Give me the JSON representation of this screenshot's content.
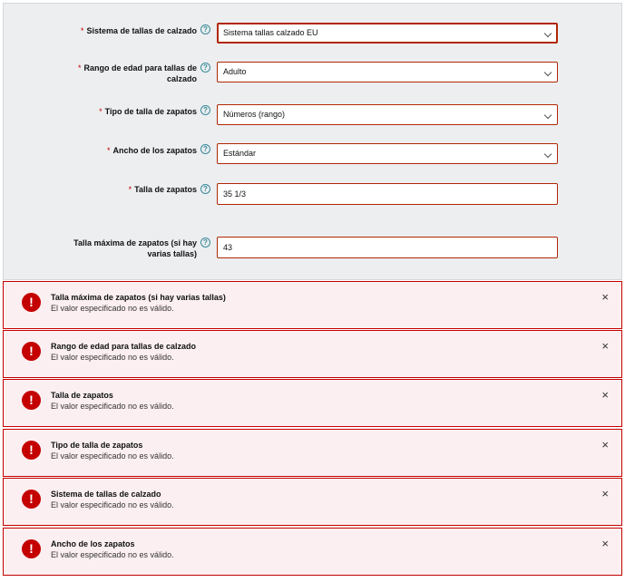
{
  "form": {
    "fields": [
      {
        "label": "Sistema de tallas de calzado",
        "required": "*",
        "help_icon": "?",
        "value": "Sistema tallas calzado EU",
        "type": "select"
      },
      {
        "label": "Rango de edad para tallas de calzado",
        "required": "*",
        "help_icon": "?",
        "value": "Adulto",
        "type": "select"
      },
      {
        "label": "Tipo de talla de zapatos",
        "required": "*",
        "help_icon": "?",
        "value": "Números (rango)",
        "type": "select"
      },
      {
        "label": "Ancho de los zapatos",
        "required": "*",
        "help_icon": "?",
        "value": "Estándar",
        "type": "select"
      },
      {
        "label": "Talla de zapatos",
        "required": "*",
        "help_icon": "?",
        "value": "35 1/3",
        "type": "input"
      },
      {
        "label": "Talla máxima de zapatos (si hay varias tallas)",
        "required": "",
        "help_icon": "?",
        "value": "43",
        "type": "input"
      }
    ]
  },
  "alerts": [
    {
      "title": "Talla máxima de zapatos (si hay varias tallas)",
      "message": "El valor especificado no es válido.",
      "icon": "!",
      "close": "×"
    },
    {
      "title": "Rango de edad para tallas de calzado",
      "message": "El valor especificado no es válido.",
      "icon": "!",
      "close": "×"
    },
    {
      "title": "Talla de zapatos",
      "message": "El valor especificado no es válido.",
      "icon": "!",
      "close": "×"
    },
    {
      "title": "Tipo de talla de zapatos",
      "message": "El valor especificado no es válido.",
      "icon": "!",
      "close": "×"
    },
    {
      "title": "Sistema de tallas de calzado",
      "message": "El valor especificado no es válido.",
      "icon": "!",
      "close": "×"
    },
    {
      "title": "Ancho de los zapatos",
      "message": "El valor especificado no es válido.",
      "icon": "!",
      "close": "×"
    }
  ],
  "colors": {
    "error": "#c40000",
    "alert_bg": "#fceff1",
    "panel_bg": "#eceef0",
    "help": "#3a8a99"
  }
}
